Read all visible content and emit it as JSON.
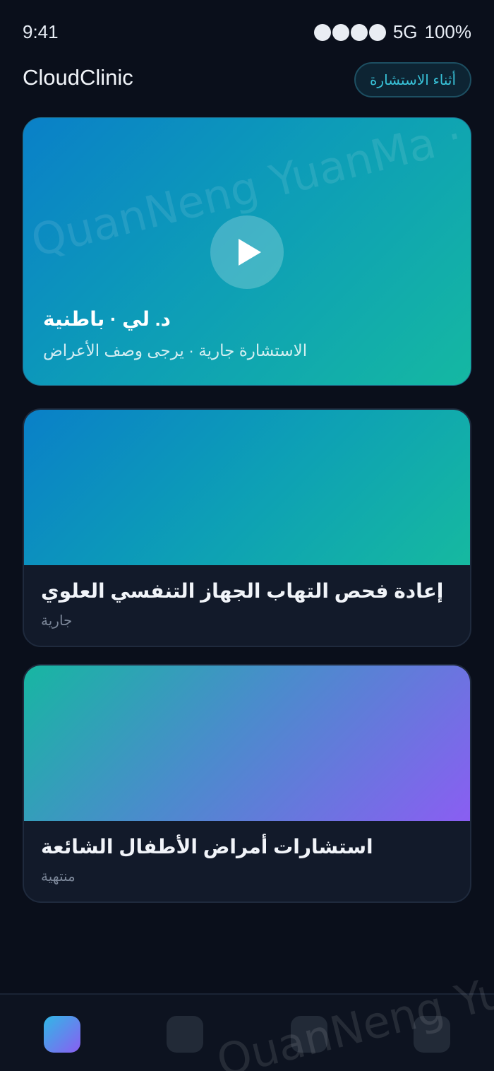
{
  "status_bar": {
    "time": "9:41",
    "network": "5G",
    "battery": "100%",
    "signal_dots": 4
  },
  "header": {
    "app_title": "CloudClinic",
    "status_pill": "أثناء الاستشارة"
  },
  "video_call": {
    "doctor": "د. لي · باطنية",
    "status_text": "الاستشارة جارية · يرجى وصف الأعراض",
    "play_icon": "play-icon"
  },
  "consultations": [
    {
      "title": "إعادة فحص التهاب الجهاز التنفسي العلوي",
      "status": "جارية"
    },
    {
      "title": "استشارات أمراض الأطفال الشائعة",
      "status": "منتهية"
    }
  ],
  "watermark": {
    "text_top": "QuanNeng YuanMa · in",
    "text_bottom": "QuanNeng YuanMa"
  },
  "bottom_nav": {
    "items": [
      "home-tab-icon",
      "consultations-tab-icon",
      "messages-tab-icon",
      "profile-tab-icon"
    ],
    "active_index": 0
  },
  "colors": {
    "background": "#0a0f1b",
    "accent_teal": "#38c2d8",
    "card_bg": "#121a2a"
  }
}
